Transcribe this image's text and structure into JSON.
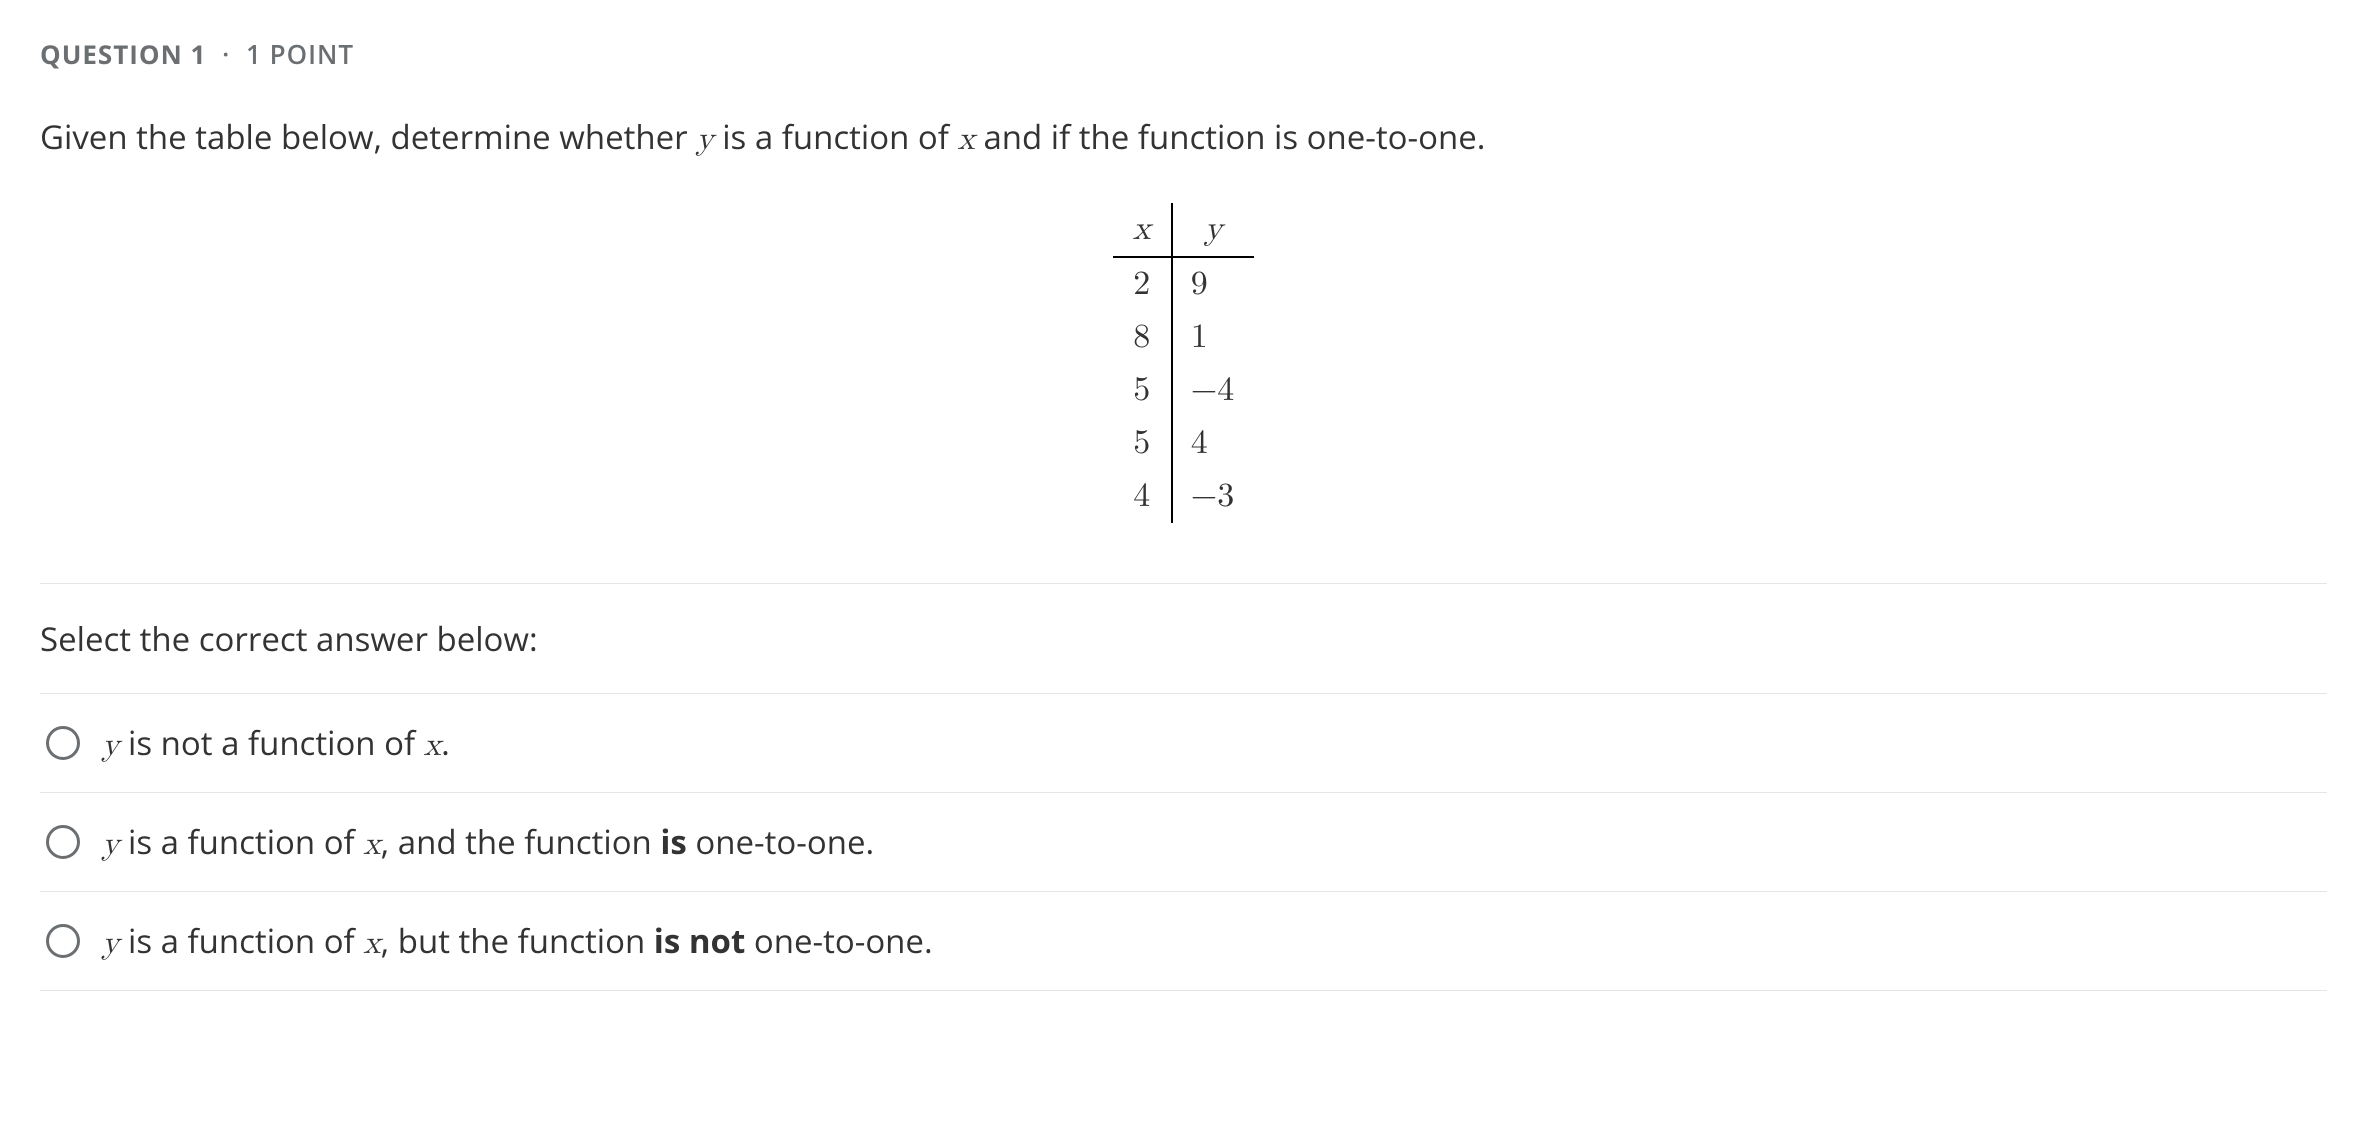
{
  "header": {
    "question_label": "QUESTION",
    "question_number": "1",
    "separator": "·",
    "points": "1 POINT"
  },
  "prompt": {
    "pre": "Given the table below, determine whether ",
    "var_y": "y",
    "mid1": " is a function of ",
    "var_x": "x",
    "post": " and if the function is one-to-one."
  },
  "chart_data": {
    "type": "table",
    "columns": [
      "x",
      "y"
    ],
    "rows": [
      {
        "x": "2",
        "y": "9"
      },
      {
        "x": "8",
        "y": "1"
      },
      {
        "x": "5",
        "y": "−4"
      },
      {
        "x": "5",
        "y": "4"
      },
      {
        "x": "4",
        "y": "−3"
      }
    ]
  },
  "select_prompt": "Select the correct answer below:",
  "options": [
    {
      "parts": [
        {
          "text": "y",
          "class": "mathit"
        },
        {
          "text": " is not a function of "
        },
        {
          "text": "x",
          "class": "mathit"
        },
        {
          "text": "."
        }
      ]
    },
    {
      "parts": [
        {
          "text": "y",
          "class": "mathit"
        },
        {
          "text": " is a function of "
        },
        {
          "text": "x",
          "class": "mathit"
        },
        {
          "text": ", and the function "
        },
        {
          "text": "is",
          "class": "bold"
        },
        {
          "text": " one-to-one."
        }
      ]
    },
    {
      "parts": [
        {
          "text": "y",
          "class": "mathit"
        },
        {
          "text": " is a function of "
        },
        {
          "text": "x",
          "class": "mathit"
        },
        {
          "text": ", but the function "
        },
        {
          "text": "is not",
          "class": "bold"
        },
        {
          "text": " one-to-one."
        }
      ]
    }
  ]
}
